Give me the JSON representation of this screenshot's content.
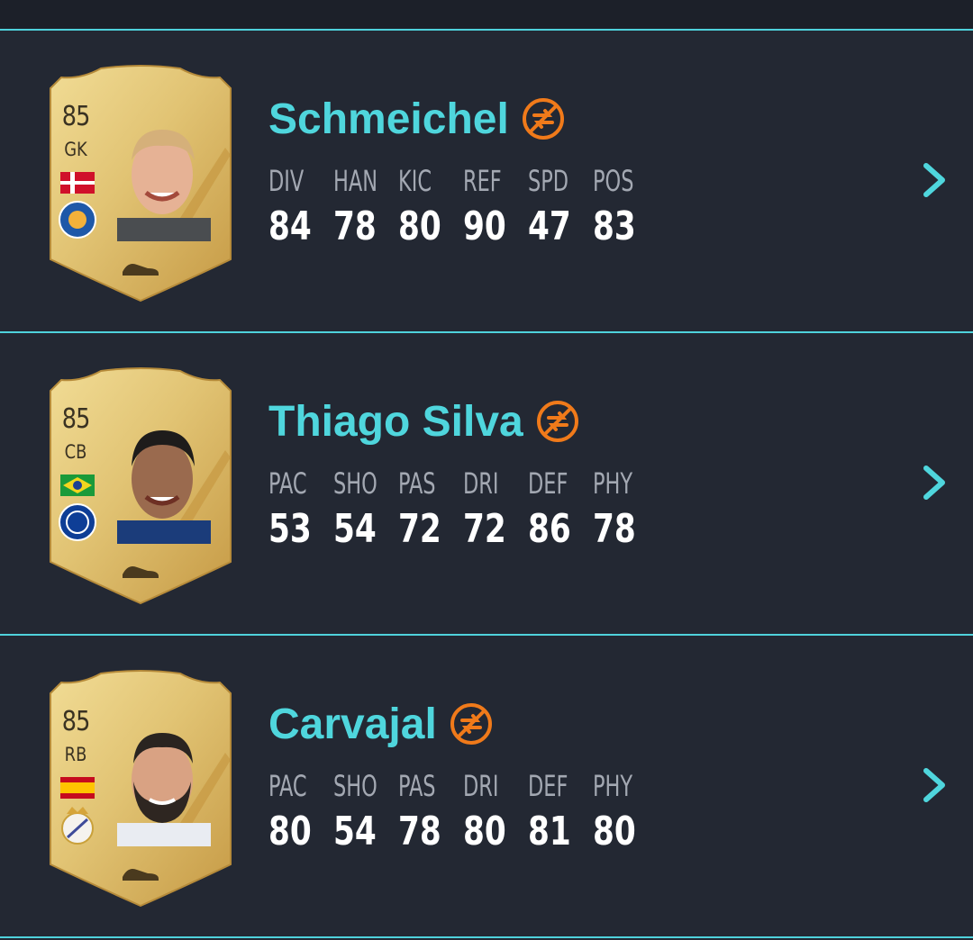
{
  "colors": {
    "background": "#232833",
    "accent": "#4fd6dd",
    "untradeable": "#f07a1a",
    "card_gold": "#d9b65a"
  },
  "icons": {
    "untradeable": "untradeable-icon",
    "chevron": "chevron-right-icon",
    "boot": "boot-icon"
  },
  "players": [
    {
      "name": "Schmeichel",
      "rating": "85",
      "position": "GK",
      "nation": "Denmark",
      "club": "Leicester City",
      "stats": [
        {
          "label": "DIV",
          "value": "84"
        },
        {
          "label": "HAN",
          "value": "78"
        },
        {
          "label": "KIC",
          "value": "80"
        },
        {
          "label": "REF",
          "value": "90"
        },
        {
          "label": "SPD",
          "value": "47"
        },
        {
          "label": "POS",
          "value": "83"
        }
      ]
    },
    {
      "name": "Thiago Silva",
      "rating": "85",
      "position": "CB",
      "nation": "Brazil",
      "club": "Chelsea",
      "stats": [
        {
          "label": "PAC",
          "value": "53"
        },
        {
          "label": "SHO",
          "value": "54"
        },
        {
          "label": "PAS",
          "value": "72"
        },
        {
          "label": "DRI",
          "value": "72"
        },
        {
          "label": "DEF",
          "value": "86"
        },
        {
          "label": "PHY",
          "value": "78"
        }
      ]
    },
    {
      "name": "Carvajal",
      "rating": "85",
      "position": "RB",
      "nation": "Spain",
      "club": "Real Madrid",
      "stats": [
        {
          "label": "PAC",
          "value": "80"
        },
        {
          "label": "SHO",
          "value": "54"
        },
        {
          "label": "PAS",
          "value": "78"
        },
        {
          "label": "DRI",
          "value": "80"
        },
        {
          "label": "DEF",
          "value": "81"
        },
        {
          "label": "PHY",
          "value": "80"
        }
      ]
    }
  ]
}
